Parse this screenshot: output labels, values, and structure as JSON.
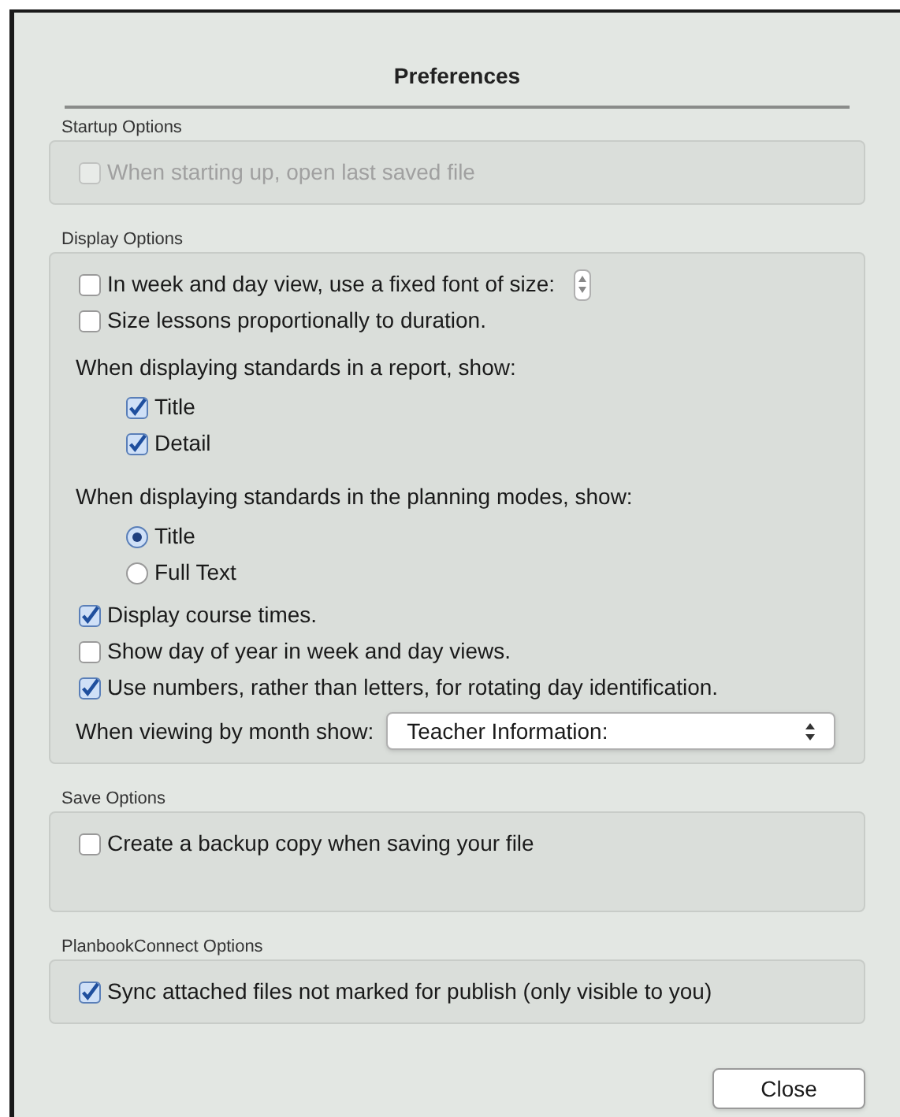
{
  "window": {
    "title": "Preferences"
  },
  "sections": [
    {
      "title": "Startup Options",
      "items": [
        {
          "kind": "checkbox",
          "label": "When starting up, open last saved file",
          "checked": false,
          "disabled": true
        }
      ]
    },
    {
      "title": "Display Options",
      "items": [
        {
          "kind": "checkbox",
          "label": "In week and day view, use a fixed font of size:",
          "checked": false,
          "disabled": false,
          "stepper": true
        },
        {
          "kind": "checkbox",
          "label": "Size lessons proportionally to duration.",
          "checked": false,
          "disabled": false
        },
        {
          "kind": "heading",
          "label": "When displaying standards in a report, show:",
          "children": [
            {
              "kind": "checkbox",
              "label": "Title",
              "checked": true,
              "disabled": false
            },
            {
              "kind": "checkbox",
              "label": "Detail",
              "checked": true,
              "disabled": false
            }
          ]
        },
        {
          "kind": "heading",
          "label": "When displaying standards in the planning modes, show:",
          "children": [
            {
              "kind": "radio",
              "label": "Title",
              "selected": true
            },
            {
              "kind": "radio",
              "label": "Full Text",
              "selected": false
            }
          ]
        },
        {
          "kind": "checkbox",
          "label": "Display course times.",
          "checked": true,
          "disabled": false
        },
        {
          "kind": "checkbox",
          "label": "Show day of year in week and day views.",
          "checked": false,
          "disabled": false
        },
        {
          "kind": "checkbox",
          "label": "Use numbers, rather than letters, for rotating day identification.",
          "checked": true,
          "disabled": false
        },
        {
          "kind": "select",
          "label": "When viewing by month show:",
          "value": "Teacher Information:"
        }
      ]
    },
    {
      "title": "Save Options",
      "tall": true,
      "items": [
        {
          "kind": "checkbox",
          "label": "Create a backup copy when saving your file",
          "checked": false,
          "disabled": false
        }
      ]
    },
    {
      "title": "PlanbookConnect Options",
      "items": [
        {
          "kind": "checkbox",
          "label": "Sync attached files not marked for publish (only visible to you)",
          "checked": true,
          "disabled": false
        }
      ]
    }
  ],
  "buttons": [
    {
      "label": "Close"
    }
  ]
}
